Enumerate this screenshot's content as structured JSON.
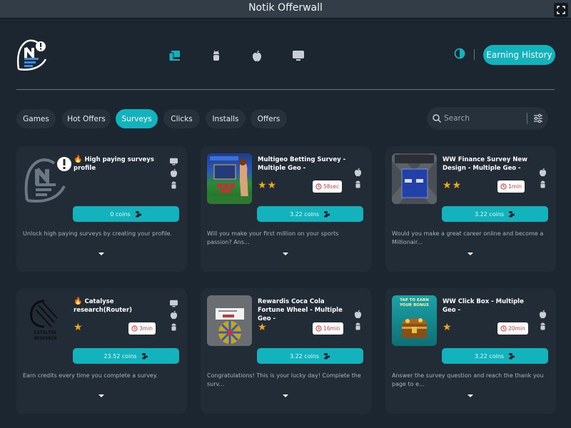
{
  "window": {
    "title": "Notik Offerwall"
  },
  "header": {
    "earning_history_label": "Earning History",
    "platforms": [
      {
        "icon": "desktop-mobile-icon",
        "active": true
      },
      {
        "icon": "android-icon",
        "active": false
      },
      {
        "icon": "apple-icon",
        "active": false
      },
      {
        "icon": "desktop-icon",
        "active": false
      }
    ],
    "accent_color": "#13b3bd"
  },
  "tabs": [
    {
      "label": "Games",
      "active": false
    },
    {
      "label": "Hot Offers",
      "active": false
    },
    {
      "label": "Surveys",
      "active": true
    },
    {
      "label": "Clicks",
      "active": false
    },
    {
      "label": "Installs",
      "active": false
    },
    {
      "label": "Offers",
      "active": false
    }
  ],
  "search": {
    "placeholder": "Search"
  },
  "offers": [
    {
      "title": "High paying surveys profile",
      "hot": true,
      "stars": 0,
      "time": "",
      "coins": "0 coins",
      "description": "Unlock high paying surveys by creating your profile.",
      "platforms": [
        "desktop-icon",
        "apple-icon",
        "android-icon"
      ],
      "thumb": "notik-logo"
    },
    {
      "title": "Multigeo Betting Survey - Multiple Geo -",
      "hot": false,
      "stars": 2,
      "time": "58sec",
      "coins": "3.22 coins",
      "description": "Will you make your first million on your sports passion? Ans...",
      "platforms": [
        "apple-icon",
        "android-icon"
      ],
      "thumb": "betting"
    },
    {
      "title": "WW Finance Survey New Design - Multiple Geo -",
      "hot": false,
      "stars": 2,
      "time": "1min",
      "coins": "3.22 coins",
      "description": "Would you make a great career online and become a Millionair...",
      "platforms": [
        "apple-icon",
        "android-icon"
      ],
      "thumb": "finance"
    },
    {
      "title": "Catalyse research(Router)",
      "hot": true,
      "stars": 1,
      "time": "3min",
      "coins": "23.52 coins",
      "description": "Earn credits every time you complete a survey.",
      "platforms": [
        "desktop-icon",
        "apple-icon",
        "android-icon"
      ],
      "thumb": "catalyse",
      "thumb_text": "CATALYSE RESEARCH"
    },
    {
      "title": "Rewardis Coca Cola Fortune Wheel - Multiple Geo -",
      "hot": false,
      "stars": 1,
      "time": "16min",
      "coins": "3.22 coins",
      "description": "Congratulations! This is your lucky day! Complete the surv...",
      "platforms": [
        "apple-icon",
        "android-icon"
      ],
      "thumb": "wheel"
    },
    {
      "title": "WW Click Box - Multiple Geo -",
      "hot": false,
      "stars": 1,
      "time": "20min",
      "coins": "3.22 coins",
      "description": "Answer the survey question and reach the thank you page to e...",
      "platforms": [
        "apple-icon",
        "android-icon"
      ],
      "thumb": "clickbox",
      "thumb_text": "TAP TO EARN YOUR BONUS"
    }
  ]
}
